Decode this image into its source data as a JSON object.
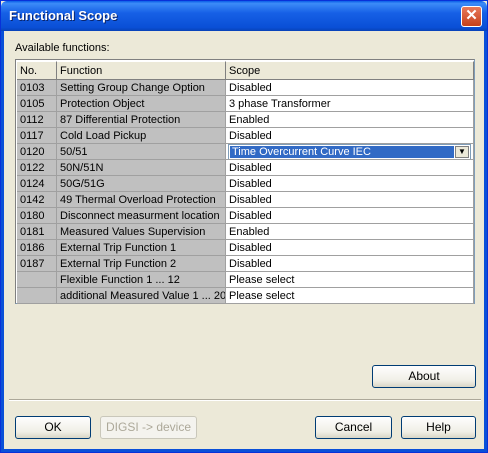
{
  "window": {
    "title": "Functional Scope"
  },
  "labels": {
    "available_functions": "Available functions:"
  },
  "table": {
    "headers": {
      "no": "No.",
      "function": "Function",
      "scope": "Scope"
    },
    "rows": [
      {
        "no": "0103",
        "function": "Setting Group Change Option",
        "scope": "Disabled"
      },
      {
        "no": "0105",
        "function": "Protection Object",
        "scope": "3 phase Transformer"
      },
      {
        "no": "0112",
        "function": "87 Differential Protection",
        "scope": "Enabled"
      },
      {
        "no": "0117",
        "function": "Cold Load Pickup",
        "scope": "Disabled"
      },
      {
        "no": "0120",
        "function": "50/51",
        "scope": "Time Overcurrent Curve  IEC"
      },
      {
        "no": "0122",
        "function": "50N/51N",
        "scope": "Disabled"
      },
      {
        "no": "0124",
        "function": "50G/51G",
        "scope": "Disabled"
      },
      {
        "no": "0142",
        "function": "49 Thermal Overload Protection",
        "scope": "Disabled"
      },
      {
        "no": "0180",
        "function": "Disconnect measurment location",
        "scope": "Disabled"
      },
      {
        "no": "0181",
        "function": "Measured Values Supervision",
        "scope": "Enabled"
      },
      {
        "no": "0186",
        "function": "External Trip Function 1",
        "scope": "Disabled"
      },
      {
        "no": "0187",
        "function": "External Trip Function 2",
        "scope": "Disabled"
      },
      {
        "no": "",
        "function": "Flexible Function 1 ... 12",
        "scope": "Please select"
      },
      {
        "no": "",
        "function": "additional Measured Value 1 ... 20",
        "scope": "Please select"
      }
    ]
  },
  "buttons": {
    "about": "About",
    "ok": "OK",
    "digsi": "DIGSI -> device",
    "cancel": "Cancel",
    "help": "Help"
  },
  "icons": {
    "close": "close-icon",
    "dropdown": "chevron-down-icon"
  },
  "colors": {
    "title_bar": "#0a5ee8",
    "selection": "#316ac5",
    "dialog_bg": "#ece9d8"
  }
}
